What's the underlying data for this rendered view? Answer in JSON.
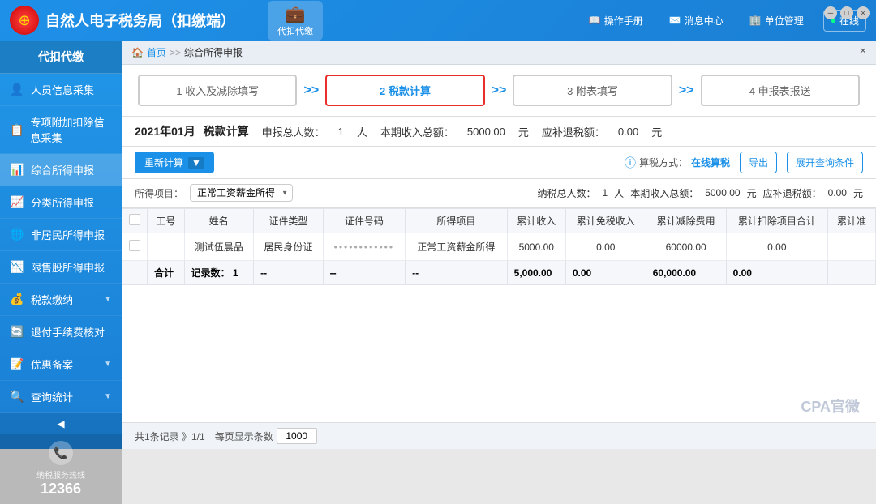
{
  "app": {
    "title": "自然人电子税务局（扣缴端）",
    "icon_label": "代扣代缴"
  },
  "topnav": {
    "manual_label": "操作手册",
    "message_label": "消息中心",
    "unit_label": "单位管理",
    "online_label": "在线"
  },
  "sidebar": {
    "header": "代扣代缴",
    "items": [
      {
        "label": "人员信息采集",
        "icon": "👤"
      },
      {
        "label": "专项附加扣除信息采集",
        "icon": "📋"
      },
      {
        "label": "综合所得申报",
        "icon": "📊"
      },
      {
        "label": "分类所得申报",
        "icon": "📈"
      },
      {
        "label": "非居民所得申报",
        "icon": "🌐"
      },
      {
        "label": "限售股所得申报",
        "icon": "📉"
      },
      {
        "label": "税款缴纳",
        "icon": "💰",
        "has_arrow": true
      },
      {
        "label": "退付手续费核对",
        "icon": "🔄"
      },
      {
        "label": "优惠备案",
        "icon": "📝",
        "has_arrow": true
      },
      {
        "label": "查询统计",
        "icon": "🔍",
        "has_arrow": true
      }
    ],
    "hotline_label": "纳税服务热线",
    "hotline_number": "12366"
  },
  "breadcrumb": {
    "home": "首页",
    "current": "综合所得申报"
  },
  "steps": [
    {
      "label": "1 收入及减除填写",
      "active": false
    },
    {
      "label": "2 税款计算",
      "active": true
    },
    {
      "label": "3 附表填写",
      "active": false
    },
    {
      "label": "4 申报表报送",
      "active": false
    }
  ],
  "info_bar": {
    "period": "2021年01月",
    "section": "税款计算",
    "report_count_label": "申报总人数：",
    "report_count": "1",
    "report_count_unit": "人",
    "income_label": "本期收入总额：",
    "income_value": "5000.00",
    "income_unit": "元",
    "refund_label": "应补退税额：",
    "refund_value": "0.00",
    "refund_unit": "元"
  },
  "toolbar": {
    "recalc_label": "重新计算",
    "tax_method_label": "算税方式：",
    "tax_method_value": "在线算税",
    "export_label": "导出",
    "expand_label": "展开查询条件"
  },
  "filter": {
    "income_type_label": "所得项目：",
    "income_type_value": "正常工资薪金所得",
    "taxpayer_label": "纳税总人数：",
    "taxpayer_count": "1",
    "taxpayer_unit": "人",
    "period_income_label": "本期收入总额：",
    "period_income": "5000.00",
    "period_income_unit": "元",
    "tax_refund_label": "应补退税额：",
    "tax_refund": "0.00",
    "tax_refund_unit": "元"
  },
  "table": {
    "headers": [
      "",
      "工号",
      "姓名",
      "证件类型",
      "证件号码",
      "所得项目",
      "累计收入",
      "累计免税收入",
      "累计减除费用",
      "累计扣除项目合计",
      "累计准"
    ],
    "rows": [
      {
        "checked": false,
        "employee_id": "",
        "name": "测试伍晨品",
        "id_type": "居民身份证",
        "id_number": "••••••••••••",
        "income_type": "正常工资薪金所得",
        "cumulative_income": "5000.00",
        "tax_exempt": "0.00",
        "deduction": "60000.00",
        "project_total": "0.00"
      }
    ],
    "footer": {
      "label": "合计",
      "record_label": "记录数：",
      "record_count": "1",
      "col3": "--",
      "col4": "--",
      "col5": "--",
      "cumulative_income": "5,000.00",
      "tax_exempt": "0.00",
      "deduction": "60,000.00",
      "project_total": "0.00"
    }
  },
  "pagination": {
    "total_label": "共1条记录 》1/1",
    "per_page_label": "每页显示条数",
    "per_page_value": "1000"
  }
}
